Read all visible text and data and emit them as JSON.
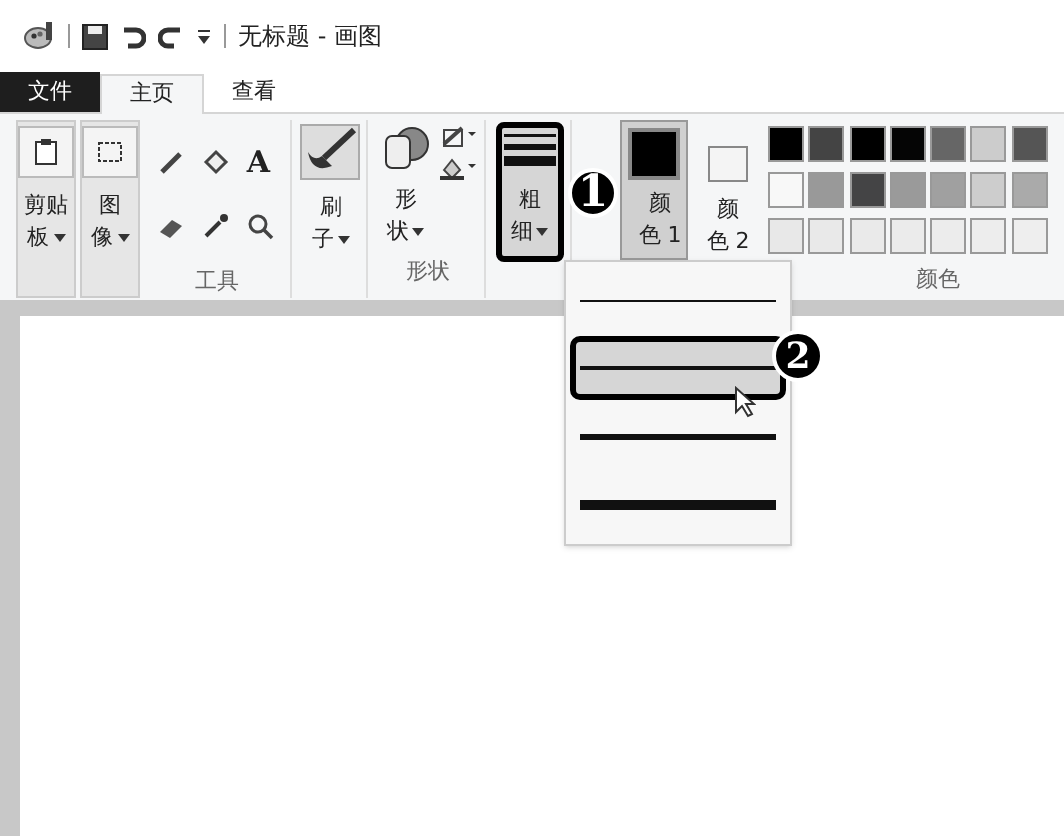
{
  "window": {
    "title": "无标题 - 画图"
  },
  "tabs": [
    {
      "label": "文件",
      "kind": "file",
      "selected": false
    },
    {
      "label": "主页",
      "kind": "tab",
      "selected": true
    },
    {
      "label": "查看",
      "kind": "tab",
      "selected": false
    }
  ],
  "ribbon": {
    "clipboard": {
      "label_lines": [
        "剪贴",
        "板"
      ]
    },
    "image": {
      "label_lines": [
        "图",
        "像"
      ]
    },
    "tools": {
      "label": "工具",
      "text_tool": "A"
    },
    "brushes": {
      "label_lines": [
        "刷",
        "子"
      ]
    },
    "shapes": {
      "label_lines": [
        "形",
        "状"
      ],
      "group_label": "形状"
    },
    "size": {
      "label_lines": [
        "粗",
        "细"
      ],
      "highlighted": true
    },
    "color1": {
      "label_lines": [
        "颜",
        "色 1"
      ],
      "selected": true,
      "color": "#000000"
    },
    "color2": {
      "label_lines": [
        "颜",
        "色 2"
      ],
      "selected": false,
      "color": "#f4f4f4"
    },
    "palette": [
      {
        "color": "#000000"
      },
      {
        "color": "#444444"
      },
      {
        "color": "#000000"
      },
      {
        "color": "#050505"
      },
      {
        "color": "#666666"
      },
      {
        "color": "#cccccc"
      },
      {
        "color": "#555555"
      },
      {
        "color": "#f8f8f8"
      },
      {
        "color": "#999999"
      },
      {
        "color": "#444445"
      },
      {
        "color": "#9a9a9a"
      },
      {
        "color": "#a0a0a0"
      },
      {
        "color": "#cdcdcd"
      },
      {
        "color": "#aaaaaa"
      },
      {
        "color": "#e8e8e8"
      },
      {
        "color": "#e9e9e9"
      },
      {
        "color": "#eaeaea"
      },
      {
        "color": "#ebebeb"
      },
      {
        "color": "#ececec"
      },
      {
        "color": "#ededed"
      },
      {
        "color": "#eeeeee"
      }
    ],
    "colors_label": "颜色"
  },
  "size_menu": [
    {
      "kind": "thin",
      "selected": false
    },
    {
      "kind": "medium",
      "selected": true
    },
    {
      "kind": "thick",
      "selected": false
    },
    {
      "kind": "heavy",
      "selected": false
    }
  ],
  "callouts": [
    "1",
    "2"
  ]
}
